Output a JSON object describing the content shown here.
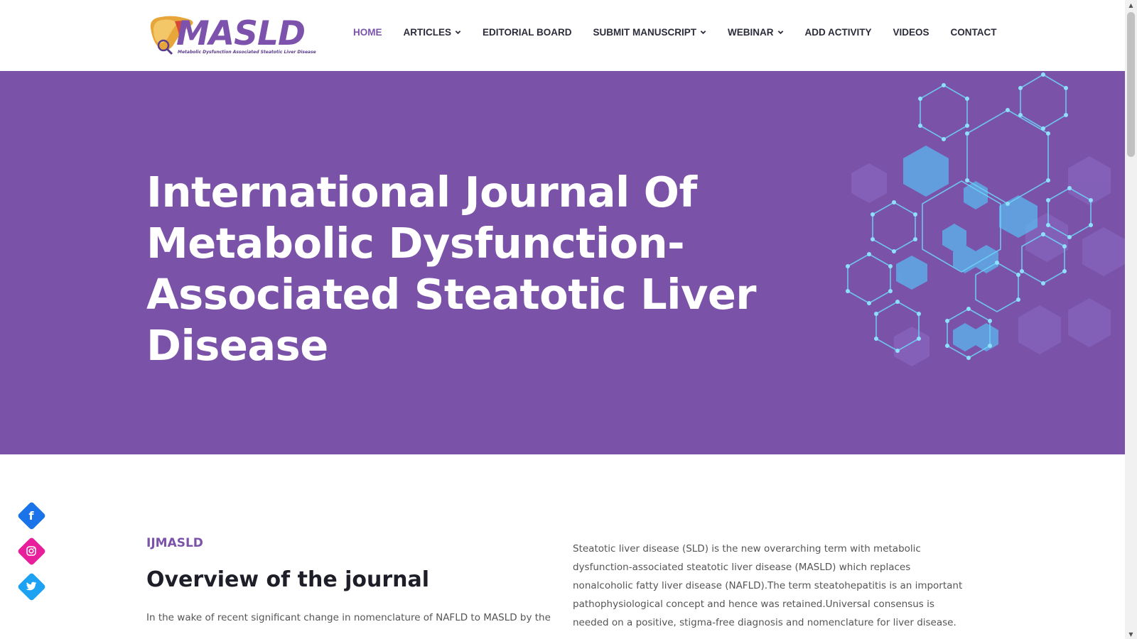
{
  "logo": {
    "name": "MASLD",
    "tagline": "Metabolic Dysfunction Associated Steatotic Liver Disease"
  },
  "nav": {
    "items": [
      {
        "label": "HOME",
        "active": true,
        "dropdown": false
      },
      {
        "label": "ARTICLES",
        "active": false,
        "dropdown": true
      },
      {
        "label": "EDITORIAL BOARD",
        "active": false,
        "dropdown": false
      },
      {
        "label": "SUBMIT MANUSCRIPT",
        "active": false,
        "dropdown": true
      },
      {
        "label": "WEBINAR",
        "active": false,
        "dropdown": true
      },
      {
        "label": "ADD ACTIVITY",
        "active": false,
        "dropdown": false
      },
      {
        "label": "VIDEOS",
        "active": false,
        "dropdown": false
      },
      {
        "label": "CONTACT",
        "active": false,
        "dropdown": false
      }
    ]
  },
  "hero": {
    "title": "International Journal Of Metabolic Dysfunction-Associated Steatotic Liver Disease",
    "background_color": "#7a53a9"
  },
  "main": {
    "eyebrow": "IJMASLD",
    "section_title": "Overview of the journal",
    "intro": "In the wake of recent significant change in nomenclature of NAFLD to MASLD by the",
    "description": "Steatotic liver disease (SLD) is the new overarching term with metabolic dysfunction-associated steatotic liver disease (MASLD) which replaces nonalcoholic fatty liver disease (NAFLD).The term steatohepatitis is an important pathophysiological concept and hence was retained.Universal consensus is needed on a positive, stigma-free diagnosis and nomenclature for liver disease."
  },
  "social": [
    {
      "icon": "facebook-icon",
      "glyph": "f",
      "color": "#1a73e8"
    },
    {
      "icon": "instagram-icon",
      "glyph": "◎",
      "color": "#e91e9a"
    },
    {
      "icon": "twitter-icon",
      "glyph": "🐦",
      "color": "#1da1f2"
    }
  ],
  "colors": {
    "accent": "#7b54a9",
    "nav_text": "#2b2b3a"
  }
}
